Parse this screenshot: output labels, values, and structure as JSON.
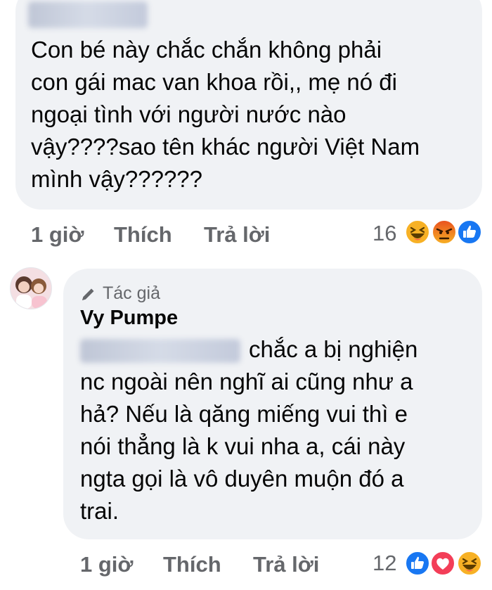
{
  "comment1": {
    "author_redacted": "Hoang Nguyen",
    "text": "Con bé này chắc chắn không phải\ncon gái mac van khoa rồi,, mẹ nó đi\nngoại tình với người nước nào\nvậy????sao tên khác người Việt Nam\nmình vậy??????",
    "time": "1 giờ",
    "like_label": "Thích",
    "reply_label": "Trả lời",
    "reaction_count": "16",
    "reactions": [
      "haha-emoji-icon",
      "angry-emoji-icon",
      "like-thumb-icon"
    ]
  },
  "comment2": {
    "author_badge": "Tác giả",
    "author_badge_icon": "pencil-icon",
    "author_name": "Vy Pumpe",
    "mention_redacted": "Hoang Nguyen",
    "text_first": "chắc a bị nghiện",
    "text": "nc ngoài nên nghĩ ai cũng như a\nhả? Nếu là qăng miếng vui thì e\nnói thẳng là k vui nha a, cái này\nngta gọi là vô duyên muộn đó a\ntrai.",
    "time": "1 giờ",
    "like_label": "Thích",
    "reply_label": "Trả lời",
    "reaction_count": "12",
    "reactions": [
      "like-thumb-icon",
      "love-heart-icon",
      "haha-emoji-icon"
    ]
  },
  "colors": {
    "bubble": "#f0f2f5",
    "meta_text": "#65676b",
    "like_blue": "#1877f2",
    "love_red": "#f33e58",
    "haha_yellow": "#f7b125"
  }
}
